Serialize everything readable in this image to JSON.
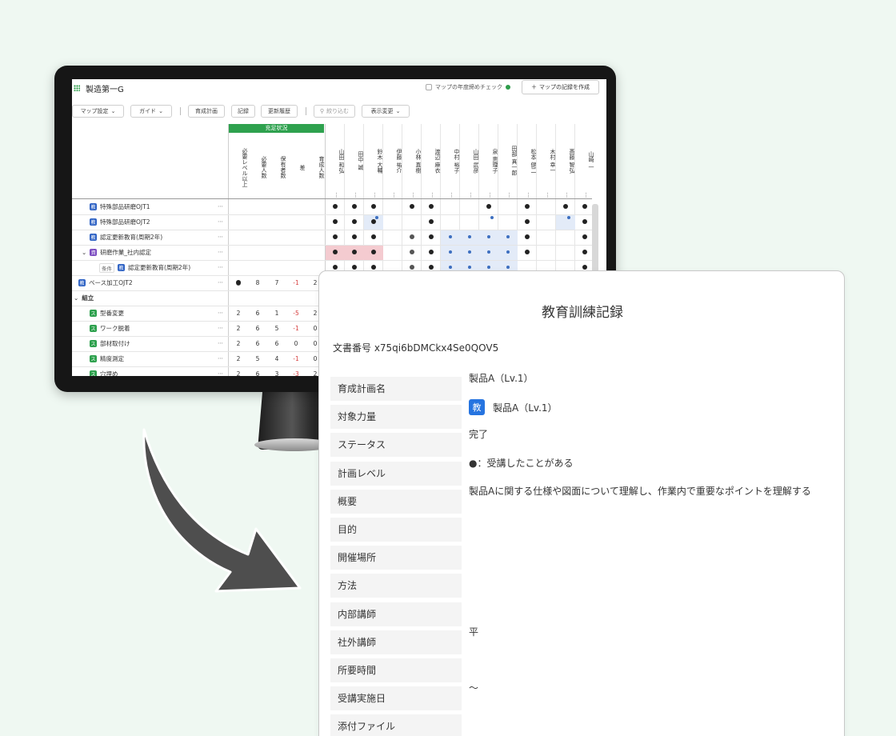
{
  "app": {
    "map_title": "製造第一G",
    "yearend_check_label": "マップの年度締めチェック",
    "create_record_label": "マップの記録を作成"
  },
  "toolbar": {
    "map_settings": "マップ設定",
    "guide": "ガイド",
    "training_plan": "育成計画",
    "record": "記録",
    "update_history": "更新履歴",
    "filter": "絞り込む",
    "display_change": "表示変更"
  },
  "matrix": {
    "group_header": "充足状況",
    "stat_columns": [
      "必要レベル以上",
      "必要人数",
      "保有者数",
      "差",
      "育成人数"
    ],
    "people": [
      "山田 和弘",
      "田中 誠",
      "鈴木 大輔",
      "伊藤 祐介",
      "小林 直樹",
      "渡辺 麻衣",
      "中村 裕子",
      "山田 武彦",
      "泉 恵理子",
      "田部 真一郎",
      "松本 健二",
      "木村 幸一",
      "斎藤 智弘",
      "山崎 一"
    ],
    "rows": [
      {
        "label": "特殊部品研磨OJT1",
        "badge": "教",
        "stats": [
          "",
          "",
          "",
          "",
          ""
        ]
      },
      {
        "label": "特殊部品研磨OJT2",
        "badge": "教",
        "stats": [
          "",
          "",
          "",
          "",
          ""
        ]
      },
      {
        "label": "認定更新教育(周期2年)",
        "badge": "教",
        "stats": [
          "",
          "",
          "",
          "",
          ""
        ]
      },
      {
        "label": "研磨作業_社内認定",
        "badge": "資",
        "stats": [
          "",
          "",
          "",
          "",
          ""
        ]
      },
      {
        "label": "認定更新教育(周期2年)",
        "badge": "教",
        "cond": "条件",
        "stats": [
          "",
          "",
          "",
          "",
          ""
        ]
      },
      {
        "label": "ベース加工OJT2",
        "badge": "教",
        "stats": [
          "●",
          "8",
          "7",
          "-1",
          "2"
        ]
      },
      {
        "label": "組立",
        "badge": "",
        "stats": [
          "",
          "",
          "",
          "",
          ""
        ]
      },
      {
        "label": "型番変更",
        "badge": "ス",
        "stats": [
          "2",
          "6",
          "1",
          "-5",
          "2"
        ]
      },
      {
        "label": "ワーク脱着",
        "badge": "ス",
        "stats": [
          "2",
          "6",
          "5",
          "-1",
          "0"
        ]
      },
      {
        "label": "部材取付け",
        "badge": "ス",
        "stats": [
          "2",
          "6",
          "6",
          "0",
          "0"
        ]
      },
      {
        "label": "精度測定",
        "badge": "ス",
        "stats": [
          "2",
          "5",
          "4",
          "-1",
          "0"
        ]
      },
      {
        "label": "穴埋め",
        "badge": "ス",
        "stats": [
          "2",
          "6",
          "3",
          "-3",
          "2"
        ]
      }
    ]
  },
  "document": {
    "title": "教育訓練記録",
    "doc_number": "文書番号 x75qi6bDMCkx4Se0QOV5",
    "fields": [
      {
        "label": "育成計画名",
        "value": "製品A（Lv.1）"
      },
      {
        "label": "対象力量",
        "badge": "教",
        "value": "製品A（Lv.1）"
      },
      {
        "label": "ステータス",
        "value": "完了"
      },
      {
        "label": "計画レベル",
        "value": "●：受講したことがある"
      },
      {
        "label": "概要",
        "value": "製品Aに関する仕様や図面について理解し、作業内で重要なポイントを理解する"
      },
      {
        "label": "目的",
        "value": ""
      },
      {
        "label": "開催場所",
        "value": ""
      },
      {
        "label": "方法",
        "value": ""
      },
      {
        "label": "内部講師",
        "value": ""
      },
      {
        "label": "社外講師",
        "value": "平"
      },
      {
        "label": "所要時間",
        "value": ""
      },
      {
        "label": "受講実施日",
        "value": "〜"
      },
      {
        "label": "添付ファイル",
        "value": ""
      }
    ]
  },
  "icons": {
    "app_grid": "app-grid-icon",
    "help": "help-icon",
    "plus": "plus-icon",
    "chevron": "chevron-down-icon",
    "filter": "filter-icon",
    "arrow": "curved-arrow-icon"
  },
  "colors": {
    "background": "#eff8f2",
    "accent_green": "#2ea14e",
    "badge_blue": "#2e62c4",
    "badge_purple": "#7b4bc0",
    "doc_badge_blue": "#2674e0",
    "highlight_pink": "#f4cbd0",
    "highlight_blue": "#e3ebf8"
  }
}
